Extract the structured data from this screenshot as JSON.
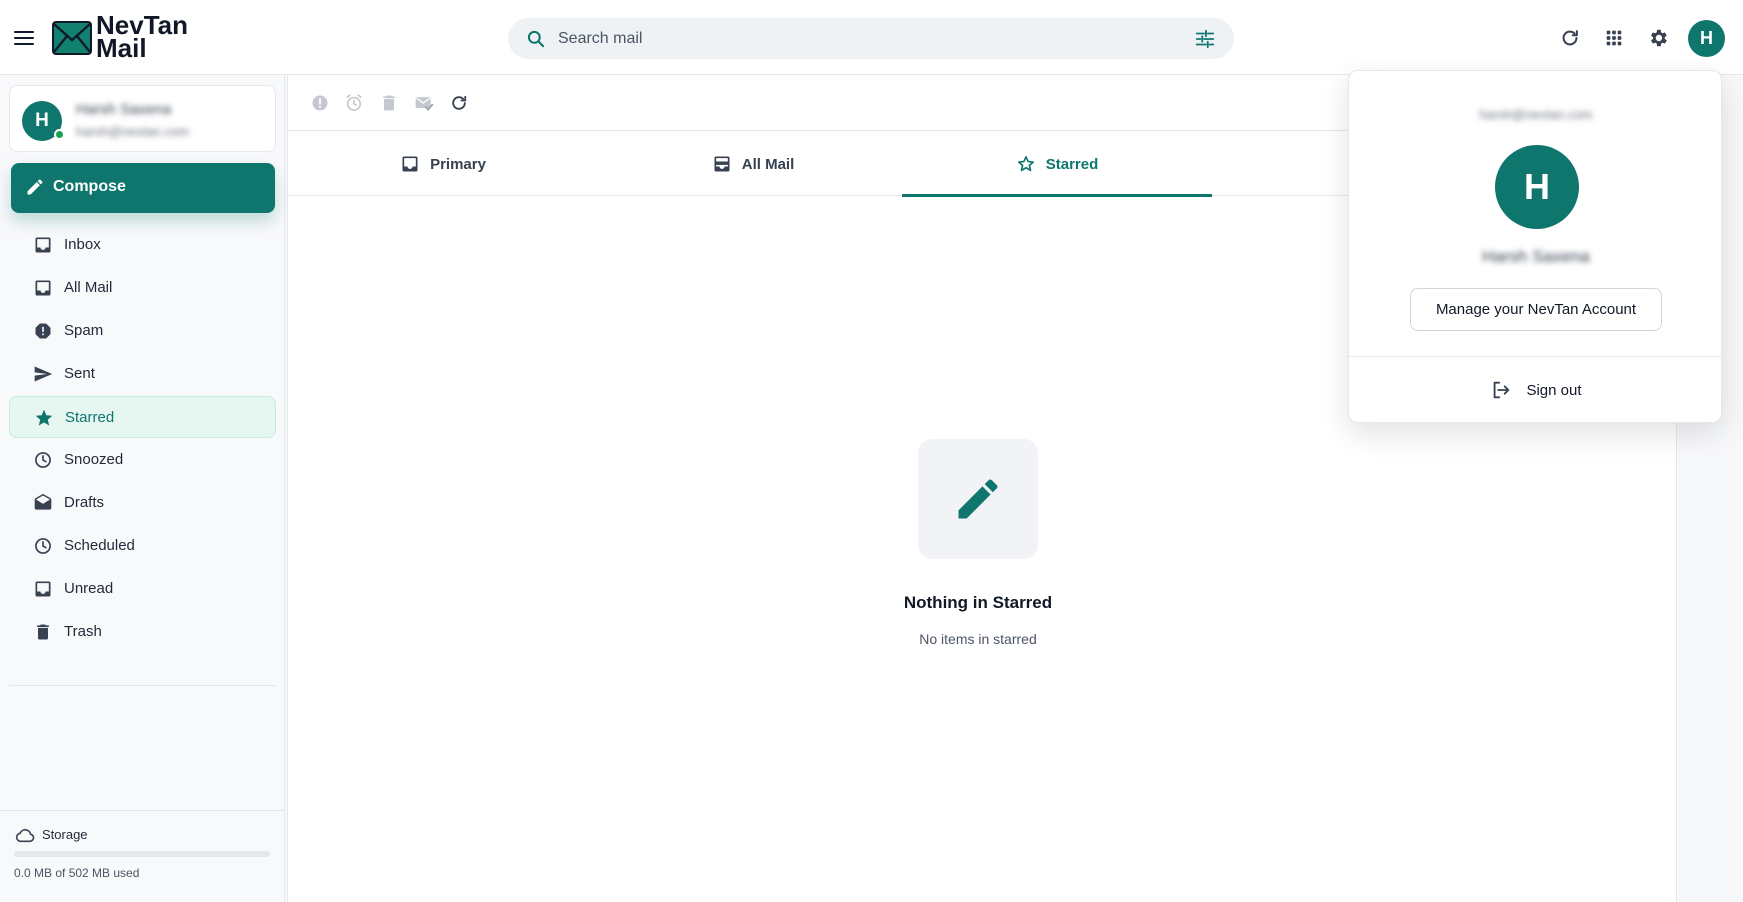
{
  "brand": {
    "line1": "NevTan",
    "line2": "Mail",
    "accent_color": "#0f766e",
    "logo_color": "#10826f"
  },
  "header": {
    "menu_icon": "hamburger-menu-icon",
    "search_placeholder": "Search mail",
    "search_icon": "search-icon",
    "filter_icon": "tune-icon",
    "refresh_icon": "refresh-icon",
    "apps_icon": "apps-grid-icon",
    "settings_icon": "gear-icon",
    "avatar_initial": "H"
  },
  "account": {
    "initial": "H",
    "name": "Harsh Saxena",
    "email": "harsh@nevtan.com",
    "status": "online"
  },
  "compose": {
    "label": "Compose",
    "icon": "pencil-icon"
  },
  "nav": {
    "items": [
      {
        "label": "Inbox",
        "icon": "inbox-icon",
        "active": false
      },
      {
        "label": "All Mail",
        "icon": "inbox-icon",
        "active": false
      },
      {
        "label": "Spam",
        "icon": "alert-octagon-icon",
        "active": false
      },
      {
        "label": "Sent",
        "icon": "send-icon",
        "active": false
      },
      {
        "label": "Starred",
        "icon": "star-icon",
        "active": true
      },
      {
        "label": "Snoozed",
        "icon": "clock-icon",
        "active": false
      },
      {
        "label": "Drafts",
        "icon": "envelope-open-icon",
        "active": false
      },
      {
        "label": "Scheduled",
        "icon": "clock-icon",
        "active": false
      },
      {
        "label": "Unread",
        "icon": "inbox-icon",
        "active": false
      },
      {
        "label": "Trash",
        "icon": "trash-icon",
        "active": false
      }
    ]
  },
  "storage": {
    "label": "Storage",
    "icon": "cloud-icon",
    "used_text": "0.0 MB of 502 MB used",
    "used_fraction": 0.0
  },
  "toolbar": {
    "icons": [
      "report-spam-icon",
      "snooze-icon",
      "trash-icon",
      "mark-read-icon",
      "refresh-icon"
    ]
  },
  "tabs": [
    {
      "label": "Primary",
      "icon": "inbox-icon",
      "active": false
    },
    {
      "label": "All Mail",
      "icon": "archive-tray-icon",
      "active": false
    },
    {
      "label": "Starred",
      "icon": "star-outline-icon",
      "active": true
    },
    {
      "label": "",
      "icon": "send-icon",
      "active": false
    }
  ],
  "empty_state": {
    "icon": "pencil-icon",
    "title": "Nothing in Starred",
    "subtitle": "No items in starred"
  },
  "account_menu": {
    "email": "harsh@nevtan.com",
    "initial": "H",
    "name": "Harsh Saxena",
    "manage_label": "Manage your NevTan Account",
    "signout_label": "Sign out",
    "signout_icon": "logout-icon"
  }
}
